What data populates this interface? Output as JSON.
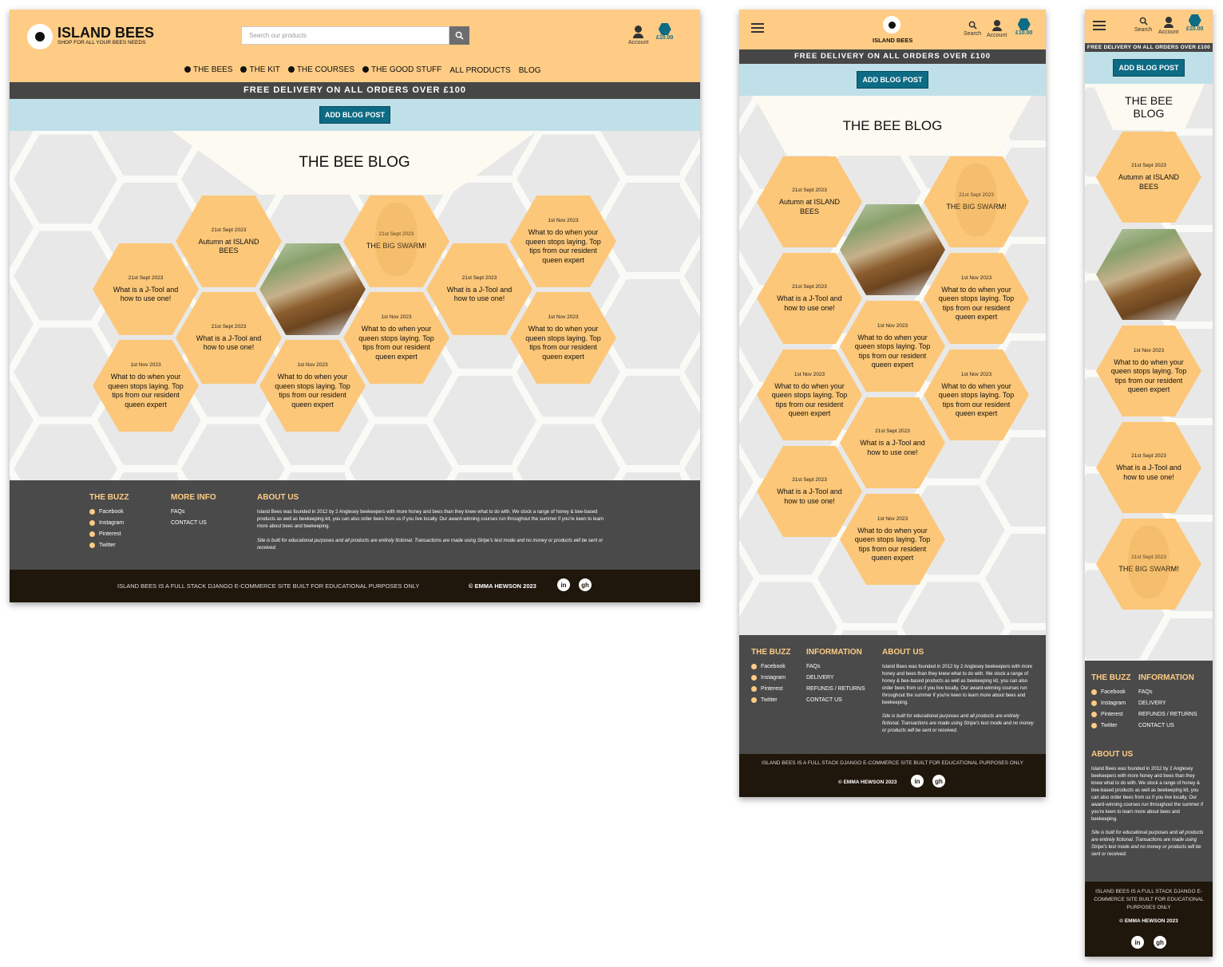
{
  "brand": {
    "name": "ISLAND BEES",
    "tagline": "SHOP FOR ALL YOUR BEES NEEDS",
    "short": "ISLAND BEES"
  },
  "search": {
    "placeholder": "Search our products",
    "label": "Search"
  },
  "account": {
    "label": "Account"
  },
  "bag": {
    "total": "£10.00"
  },
  "nav": [
    "THE BEES",
    "THE KIT",
    "THE COURSES",
    "THE GOOD STUFF",
    "ALL PRODUCTS",
    "BLOG"
  ],
  "banner": "FREE DELIVERY ON ALL ORDERS OVER £100",
  "add_blog": "ADD BLOG POST",
  "blog_title": "THE BEE BLOG",
  "posts": {
    "autumn": {
      "date": "21st Sept 2023",
      "title": "Autumn at ISLAND BEES"
    },
    "jtool": {
      "date": "21st Sept 2023",
      "title": "What is a J-Tool and how to use one!"
    },
    "swarm": {
      "date": "21st Sept 2023",
      "title": "THE BIG SWARM!"
    },
    "queen": {
      "date": "1st Nov 2023",
      "title": "What to do when your queen stops laying. Top tips from our resident queen expert"
    }
  },
  "footer": {
    "buzz_title": "THE BUZZ",
    "buzz": [
      "Facebook",
      "Instagram",
      "Pinterest",
      "Twitter"
    ],
    "more_title": "MORE INFO",
    "more": [
      "FAQs",
      "CONTACT US"
    ],
    "info_title": "INFORMATION",
    "info": [
      "FAQs",
      "DELIVERY",
      "REFUNDS / RETURNS",
      "CONTACT US"
    ],
    "about_title": "ABOUT US",
    "about": "Island Bees was founded in 2012 by 2 Anglesey beekeepers with more honey and bees than they knew what to do with.  We stock a range of honey & bee-based products as well as beekeeping kit, you can also order bees from us if you live locally. Our award-winning courses run throughout the summer if you're keen to learn more about bees and beekeeping.",
    "disclaimer": "Site is built for educational purposes and all products are entirely fictional. Transactions are made using Stripe's test mode and no money or products will be sent or received.",
    "bottom": "ISLAND BEES IS A FULL STACK DJANGO E-COMMERCE SITE BUILT FOR EDUCATIONAL PURPOSES ONLY",
    "copyright": "© EMMA HEWSON 2023",
    "linkedin": "in",
    "github": "gh"
  }
}
